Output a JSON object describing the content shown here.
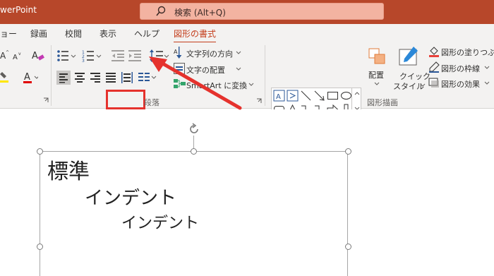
{
  "titlebar": {
    "app_title": "werPoint",
    "search_label": "検索 (Alt+Q)",
    "color": "#b7472a"
  },
  "tabs": [
    {
      "label": "ョー",
      "contextual": false
    },
    {
      "label": "録画",
      "contextual": false
    },
    {
      "label": "校閲",
      "contextual": false
    },
    {
      "label": "表示",
      "contextual": false
    },
    {
      "label": "ヘルプ",
      "contextual": false
    },
    {
      "label": "図形の書式",
      "contextual": true
    }
  ],
  "ribbon": {
    "paragraph": {
      "group_label": "段落",
      "text_direction_label": "文字列の方向",
      "align_text_label": "文字の配置",
      "smartart_label": "SmartArt に変換"
    },
    "drawing": {
      "group_label": "図形描画",
      "arrange_label": "配置",
      "quick_styles_label_1": "クイック",
      "quick_styles_label_2": "スタイル",
      "shape_fill_label": "図形の塗りつぶし",
      "shape_outline_label": "図形の枠線",
      "shape_effects_label": "図形の効果"
    },
    "font": {
      "change_case_icon": "Aa-icon"
    }
  },
  "annotation": {
    "highlight_target": "indent-buttons",
    "highlight_color": "#e5322d"
  },
  "slide": {
    "lines": [
      "標準",
      "インデント",
      "インデント"
    ]
  }
}
